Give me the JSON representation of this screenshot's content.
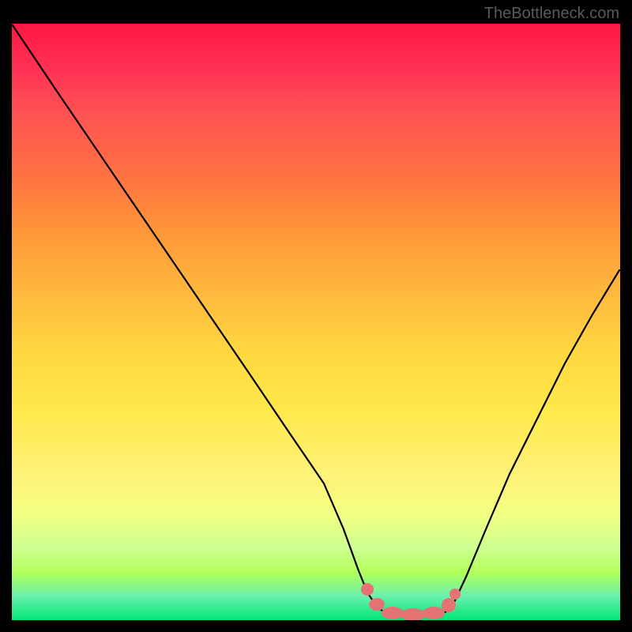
{
  "watermark": "TheBottleneck.com",
  "chart_data": {
    "type": "line",
    "title": "",
    "xlabel": "",
    "ylabel": "",
    "x": [
      0.0,
      0.05,
      0.1,
      0.15,
      0.2,
      0.25,
      0.3,
      0.35,
      0.4,
      0.45,
      0.5,
      0.55,
      0.58,
      0.6,
      0.63,
      0.66,
      0.7,
      0.75,
      0.8,
      0.85,
      0.9,
      0.95,
      1.0
    ],
    "values": [
      100,
      92,
      84,
      76,
      68,
      60,
      52,
      44,
      36,
      28,
      20,
      8,
      2,
      0,
      0,
      0,
      2,
      8,
      18,
      28,
      36,
      44,
      50
    ],
    "xlim": [
      0,
      1
    ],
    "ylim": [
      0,
      100
    ],
    "annotations": [
      {
        "type": "marker_cluster",
        "style": "pink_rounded",
        "x_range": [
          0.54,
          0.71
        ],
        "y_level": 1
      }
    ],
    "background": "vertical_gradient_red_to_green"
  }
}
